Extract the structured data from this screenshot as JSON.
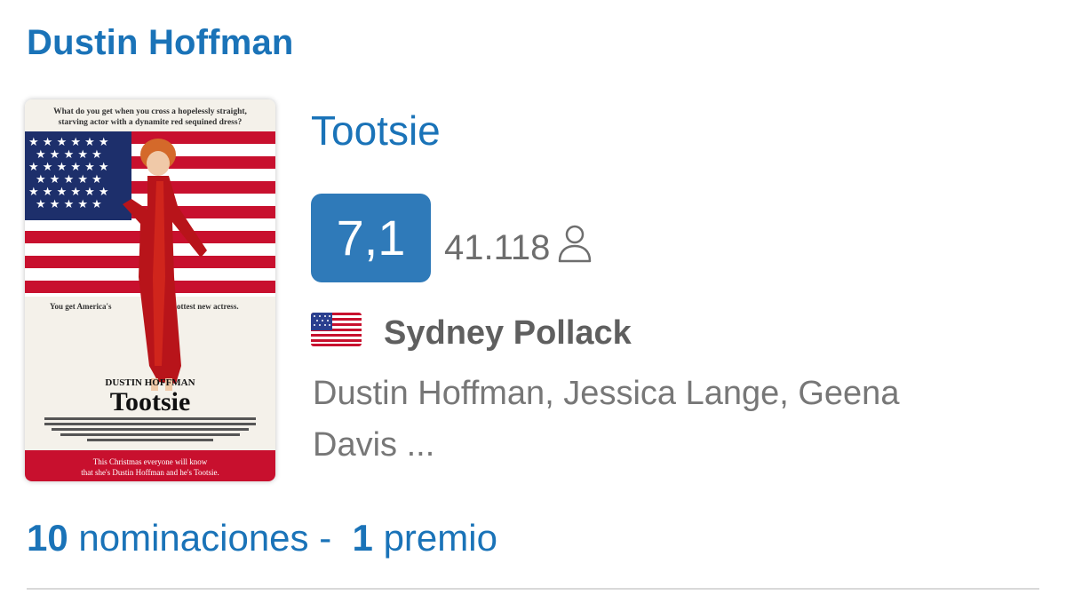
{
  "person": {
    "name": "Dustin Hoffman"
  },
  "movie": {
    "title": "Tootsie",
    "rating": "7,1",
    "votes": "41.118",
    "director": "Sydney Pollack",
    "cast": "Dustin Hoffman, Jessica Lange, Geena Davis ...",
    "country_flag": "us-flag-icon",
    "poster": {
      "tagline_top_line1": "What do you get when you cross a hopelessly straight,",
      "tagline_top_line2": "starving actor with a dynamite red sequined dress?",
      "tagline_mid_left": "You get America's",
      "tagline_mid_right": "hottest new actress.",
      "star_name": "DUSTIN HOFFMAN",
      "film_title": "Tootsie",
      "tagline_bottom_line1": "This Christmas everyone will know",
      "tagline_bottom_line2": "that she's Dustin Hoffman and he's Tootsie."
    }
  },
  "awards": {
    "nominations_count": "10",
    "nominations_label": " nominaciones -  ",
    "wins_count": "1",
    "wins_label": " premio"
  },
  "colors": {
    "accent": "#1a73b8",
    "rating_bg": "#2f7ab9",
    "muted_text": "#777777"
  }
}
